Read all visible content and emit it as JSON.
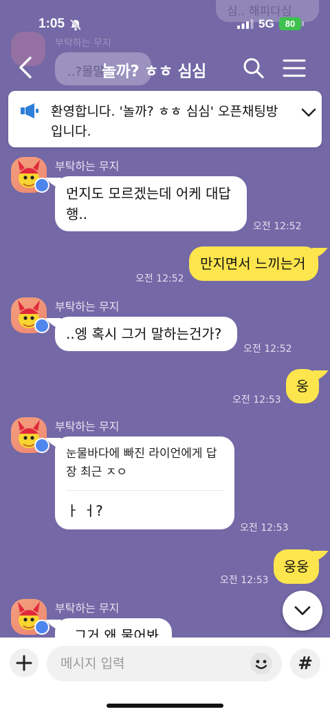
{
  "status_bar": {
    "time": "1:05",
    "network": "5G",
    "battery": "80"
  },
  "header": {
    "title": "놀까? ㅎㅎ 심심"
  },
  "background_faded": {
    "top_bubble": "심.. 해피다심",
    "sender": "부탁하는 무지",
    "bubble": "..?몰말"
  },
  "notice": {
    "text": "환영합니다. '놀까? ㅎㅎ 심심' 오픈채팅방 입니다."
  },
  "messages": [
    {
      "sender": "부탁하는 무지",
      "text": "먼지도 모르겠는데 어케 대답 행..",
      "time": "오전 12:52"
    },
    {
      "text": "만지면서 느끼는거",
      "time": "오전 12:52"
    },
    {
      "sender": "부탁하는 무지",
      "text": "..엥 혹시 그거 말하는건가?",
      "time": "오전 12:52"
    },
    {
      "text": "웅",
      "time": "오전 12:53"
    },
    {
      "sender": "부탁하는 무지",
      "reply_quote": "눈물바다에 빠진 라이언에게 답장 최근 ㅈㅇ",
      "text": "ㅏ ㅓ?",
      "time": "오전 12:53"
    },
    {
      "text": "웅웅",
      "time": "오전 12:53"
    },
    {
      "sender": "부탁하는 무지",
      "text": "그거 왜 물어봐"
    }
  ],
  "input": {
    "placeholder": "메시지 입력",
    "hash_label": "#"
  },
  "colors": {
    "background": "#7468a6",
    "my_bubble": "#fde54d",
    "other_bubble": "#ffffff"
  }
}
